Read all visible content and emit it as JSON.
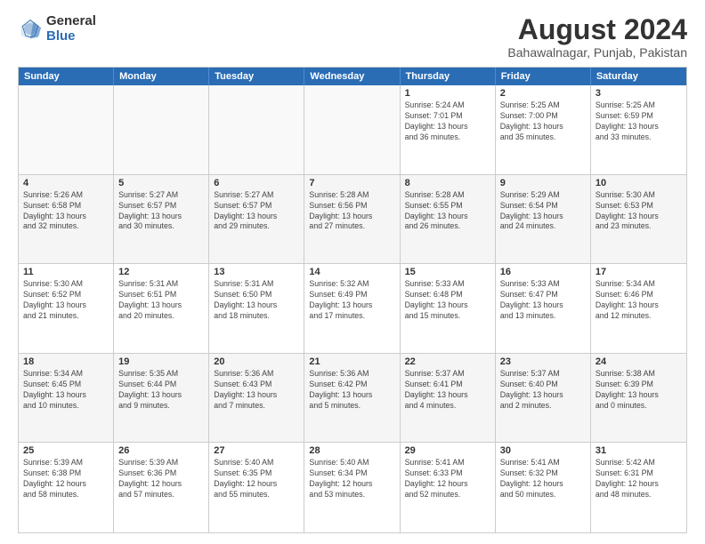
{
  "logo": {
    "general": "General",
    "blue": "Blue"
  },
  "header": {
    "title": "August 2024",
    "subtitle": "Bahawalnagar, Punjab, Pakistan"
  },
  "weekdays": [
    "Sunday",
    "Monday",
    "Tuesday",
    "Wednesday",
    "Thursday",
    "Friday",
    "Saturday"
  ],
  "weeks": [
    [
      {
        "date": "",
        "info": ""
      },
      {
        "date": "",
        "info": ""
      },
      {
        "date": "",
        "info": ""
      },
      {
        "date": "",
        "info": ""
      },
      {
        "date": "1",
        "info": "Sunrise: 5:24 AM\nSunset: 7:01 PM\nDaylight: 13 hours\nand 36 minutes."
      },
      {
        "date": "2",
        "info": "Sunrise: 5:25 AM\nSunset: 7:00 PM\nDaylight: 13 hours\nand 35 minutes."
      },
      {
        "date": "3",
        "info": "Sunrise: 5:25 AM\nSunset: 6:59 PM\nDaylight: 13 hours\nand 33 minutes."
      }
    ],
    [
      {
        "date": "4",
        "info": "Sunrise: 5:26 AM\nSunset: 6:58 PM\nDaylight: 13 hours\nand 32 minutes."
      },
      {
        "date": "5",
        "info": "Sunrise: 5:27 AM\nSunset: 6:57 PM\nDaylight: 13 hours\nand 30 minutes."
      },
      {
        "date": "6",
        "info": "Sunrise: 5:27 AM\nSunset: 6:57 PM\nDaylight: 13 hours\nand 29 minutes."
      },
      {
        "date": "7",
        "info": "Sunrise: 5:28 AM\nSunset: 6:56 PM\nDaylight: 13 hours\nand 27 minutes."
      },
      {
        "date": "8",
        "info": "Sunrise: 5:28 AM\nSunset: 6:55 PM\nDaylight: 13 hours\nand 26 minutes."
      },
      {
        "date": "9",
        "info": "Sunrise: 5:29 AM\nSunset: 6:54 PM\nDaylight: 13 hours\nand 24 minutes."
      },
      {
        "date": "10",
        "info": "Sunrise: 5:30 AM\nSunset: 6:53 PM\nDaylight: 13 hours\nand 23 minutes."
      }
    ],
    [
      {
        "date": "11",
        "info": "Sunrise: 5:30 AM\nSunset: 6:52 PM\nDaylight: 13 hours\nand 21 minutes."
      },
      {
        "date": "12",
        "info": "Sunrise: 5:31 AM\nSunset: 6:51 PM\nDaylight: 13 hours\nand 20 minutes."
      },
      {
        "date": "13",
        "info": "Sunrise: 5:31 AM\nSunset: 6:50 PM\nDaylight: 13 hours\nand 18 minutes."
      },
      {
        "date": "14",
        "info": "Sunrise: 5:32 AM\nSunset: 6:49 PM\nDaylight: 13 hours\nand 17 minutes."
      },
      {
        "date": "15",
        "info": "Sunrise: 5:33 AM\nSunset: 6:48 PM\nDaylight: 13 hours\nand 15 minutes."
      },
      {
        "date": "16",
        "info": "Sunrise: 5:33 AM\nSunset: 6:47 PM\nDaylight: 13 hours\nand 13 minutes."
      },
      {
        "date": "17",
        "info": "Sunrise: 5:34 AM\nSunset: 6:46 PM\nDaylight: 13 hours\nand 12 minutes."
      }
    ],
    [
      {
        "date": "18",
        "info": "Sunrise: 5:34 AM\nSunset: 6:45 PM\nDaylight: 13 hours\nand 10 minutes."
      },
      {
        "date": "19",
        "info": "Sunrise: 5:35 AM\nSunset: 6:44 PM\nDaylight: 13 hours\nand 9 minutes."
      },
      {
        "date": "20",
        "info": "Sunrise: 5:36 AM\nSunset: 6:43 PM\nDaylight: 13 hours\nand 7 minutes."
      },
      {
        "date": "21",
        "info": "Sunrise: 5:36 AM\nSunset: 6:42 PM\nDaylight: 13 hours\nand 5 minutes."
      },
      {
        "date": "22",
        "info": "Sunrise: 5:37 AM\nSunset: 6:41 PM\nDaylight: 13 hours\nand 4 minutes."
      },
      {
        "date": "23",
        "info": "Sunrise: 5:37 AM\nSunset: 6:40 PM\nDaylight: 13 hours\nand 2 minutes."
      },
      {
        "date": "24",
        "info": "Sunrise: 5:38 AM\nSunset: 6:39 PM\nDaylight: 13 hours\nand 0 minutes."
      }
    ],
    [
      {
        "date": "25",
        "info": "Sunrise: 5:39 AM\nSunset: 6:38 PM\nDaylight: 12 hours\nand 58 minutes."
      },
      {
        "date": "26",
        "info": "Sunrise: 5:39 AM\nSunset: 6:36 PM\nDaylight: 12 hours\nand 57 minutes."
      },
      {
        "date": "27",
        "info": "Sunrise: 5:40 AM\nSunset: 6:35 PM\nDaylight: 12 hours\nand 55 minutes."
      },
      {
        "date": "28",
        "info": "Sunrise: 5:40 AM\nSunset: 6:34 PM\nDaylight: 12 hours\nand 53 minutes."
      },
      {
        "date": "29",
        "info": "Sunrise: 5:41 AM\nSunset: 6:33 PM\nDaylight: 12 hours\nand 52 minutes."
      },
      {
        "date": "30",
        "info": "Sunrise: 5:41 AM\nSunset: 6:32 PM\nDaylight: 12 hours\nand 50 minutes."
      },
      {
        "date": "31",
        "info": "Sunrise: 5:42 AM\nSunset: 6:31 PM\nDaylight: 12 hours\nand 48 minutes."
      }
    ]
  ]
}
